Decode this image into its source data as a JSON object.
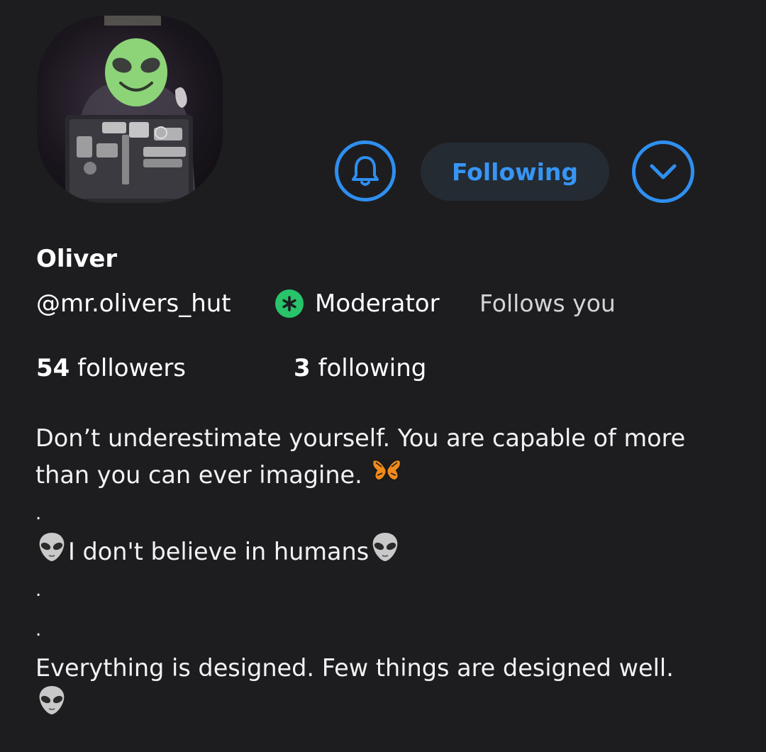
{
  "profile": {
    "name": "Oliver",
    "handle": "@mr.olivers_hut",
    "role_badge": "Moderator",
    "follows_you": "Follows you",
    "followers_count": "54",
    "followers_label": "followers",
    "following_count": "3",
    "following_label": "following"
  },
  "actions": {
    "notify_icon": "bell-icon",
    "follow_state_label": "Following",
    "more_icon": "chevron-down-icon"
  },
  "bio": {
    "line1": "Don’t underestimate yourself. You are capable of more",
    "line2": "than you can ever imagine.",
    "dot": ".",
    "line3": "I don't believe in humans",
    "line4": "Everything is designed. Few things are designed well."
  },
  "colors": {
    "background": "#1d1d20",
    "accent": "#2f8ff0",
    "moderator": "#28c36a",
    "following_button_bg": "#242b33"
  }
}
